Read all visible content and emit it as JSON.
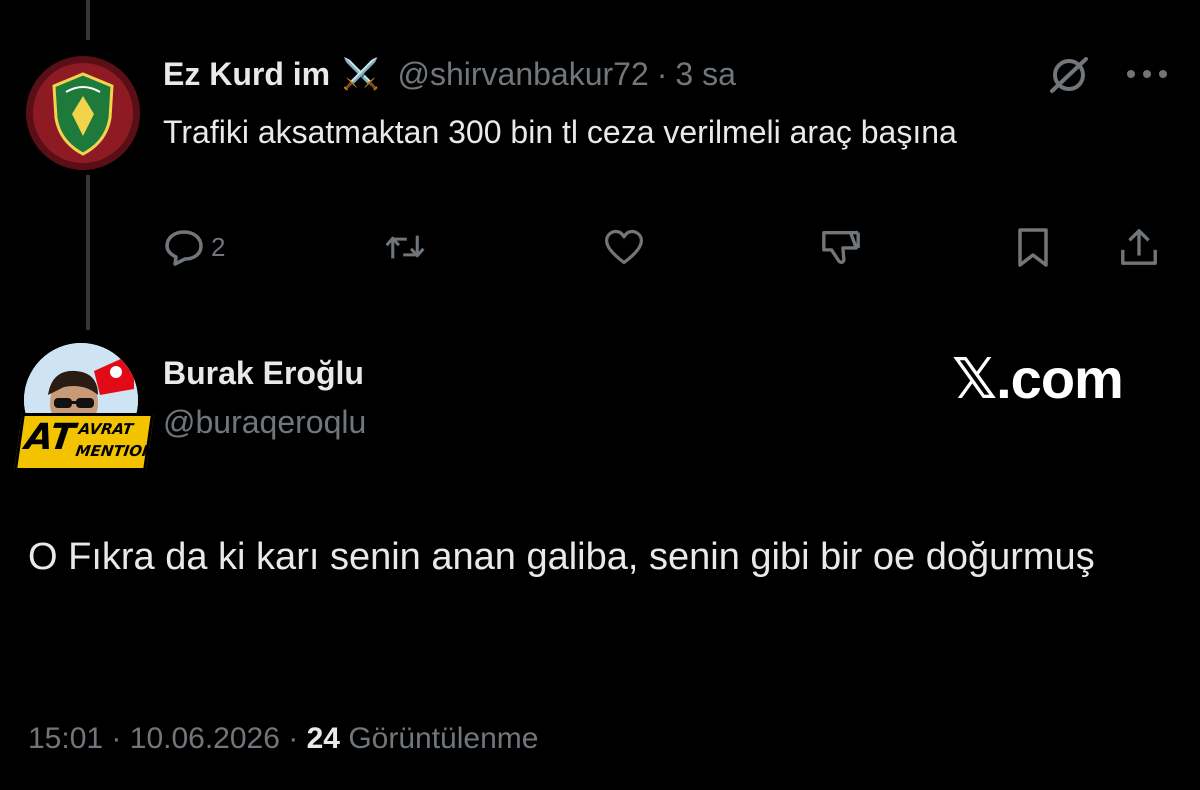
{
  "parent_tweet": {
    "display_name": "Ez Kurd im",
    "name_emoji": "⚔️",
    "handle": "@shirvanbakur72",
    "separator": "·",
    "time": "3 sa",
    "text": "Trafiki aksatmaktan 300 bin tl ceza verilmeli araç başına",
    "avatar": "amed-sk-logo",
    "actions": {
      "reply_count": "2",
      "retweet_count": "",
      "like_count": "",
      "icons": [
        "reply-icon",
        "retweet-icon",
        "like-icon",
        "dislike-icon",
        "bookmark-icon",
        "share-icon"
      ]
    }
  },
  "reply_tweet": {
    "display_name": "Burak Eroğlu",
    "handle": "@buraqeroqlu",
    "avatar_badge": {
      "main": "AT",
      "top": "AVRAT",
      "bottom": "MENTION"
    },
    "text": "O Fıkra da ki karı senin anan galiba, senin gibi bir oe doğurmuş",
    "time": "15:01",
    "date": "10.06.2026",
    "separator": "·",
    "views": "24",
    "views_label": "Görüntülenme"
  },
  "brand": "𝕏.com",
  "colors": {
    "background": "#000000",
    "text_primary": "#e7e9ea",
    "text_secondary": "#71767b",
    "thread_line": "#333639"
  }
}
